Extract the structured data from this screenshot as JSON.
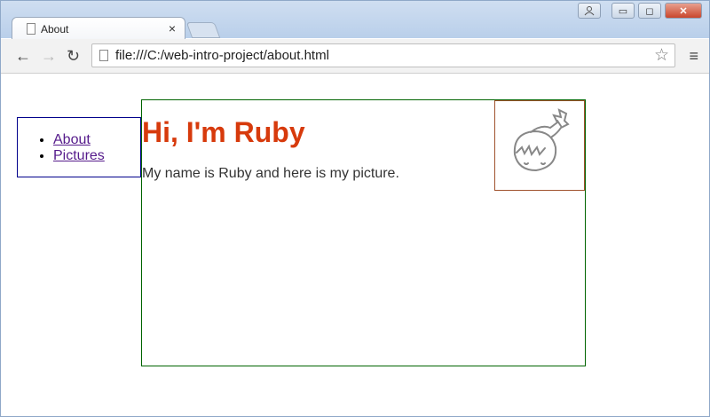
{
  "browser": {
    "tab": {
      "title": "About",
      "close_label": "×"
    },
    "address": {
      "url": "file:///C:/web-intro-project/about.html"
    },
    "window_controls": {
      "user": "",
      "minimize": "▭",
      "maximize": "◻",
      "close": "✕"
    }
  },
  "page": {
    "nav": {
      "items": [
        {
          "label": "About"
        },
        {
          "label": "Pictures"
        }
      ]
    },
    "main": {
      "heading": "Hi, I'm Ruby",
      "paragraph": "My name is Ruby and here is my picture."
    }
  },
  "colors": {
    "heading": "#d73a0c",
    "nav_border": "#00008b",
    "main_border": "#006400",
    "image_border": "#a0522d",
    "link_visited": "#551a8b"
  },
  "icons": {
    "tab": "page-icon",
    "address": "page-icon",
    "bookmark": "star-icon",
    "menu": "hamburger-icon"
  }
}
